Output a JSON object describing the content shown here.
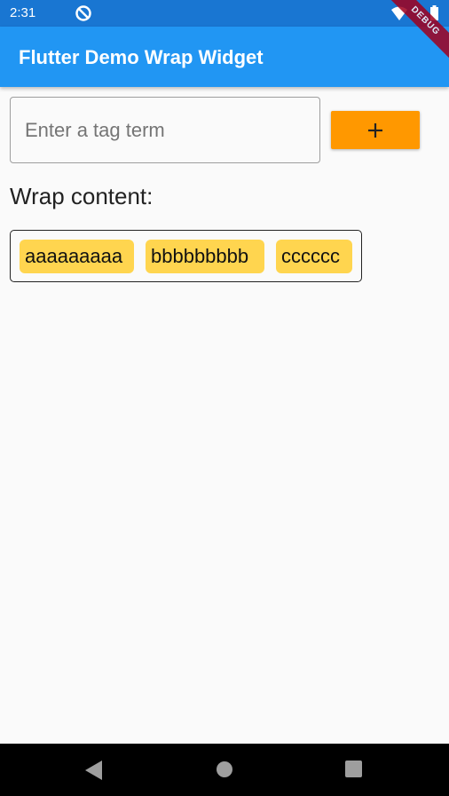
{
  "status_bar": {
    "time": "2:31",
    "icons": [
      "notification-icon",
      "wifi-icon",
      "battery-icon"
    ]
  },
  "app_bar": {
    "title": "Flutter Demo Wrap Widget",
    "color": "#2196f3"
  },
  "debug_banner": "DEBUG",
  "tag_input": {
    "placeholder": "Enter a tag term",
    "value": ""
  },
  "add_button": {
    "icon": "plus-icon",
    "color": "#ff9800"
  },
  "section_label": "Wrap content:",
  "tags": [
    {
      "label": "aaaaaaaaa"
    },
    {
      "label": "bbbbbbbbb"
    },
    {
      "label": "cccccc"
    }
  ],
  "tag_color": "#ffd54f",
  "nav_bar": {
    "icons": [
      "back-icon",
      "home-icon",
      "recent-apps-icon"
    ]
  }
}
